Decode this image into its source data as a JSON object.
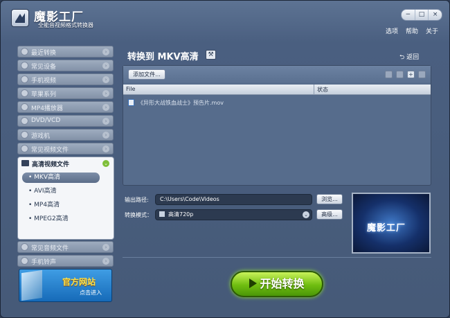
{
  "app": {
    "title": "魔影工厂",
    "subtitle": "全能音视频格式转换器",
    "top_links": [
      "选项",
      "帮助",
      "关于"
    ],
    "window_controls": [
      "−",
      "□",
      "×"
    ]
  },
  "sidebar": {
    "items_top": [
      {
        "label": "最近转换",
        "icon": "clock-icon"
      },
      {
        "label": "常见设备",
        "icon": "device-icon"
      },
      {
        "label": "手机视频",
        "icon": "phone-icon"
      },
      {
        "label": "苹果系列",
        "icon": "apple-icon"
      },
      {
        "label": "MP4播放器",
        "icon": "mp4-player-icon"
      },
      {
        "label": "DVD/VCD",
        "icon": "disc-icon"
      },
      {
        "label": "游戏机",
        "icon": "gamepad-icon"
      },
      {
        "label": "常见视频文件",
        "icon": "video-file-icon"
      }
    ],
    "open_group": {
      "label": "高清视频文件",
      "items": [
        "MKV高清",
        "AVI高清",
        "MP4高清",
        "MPEG2高清"
      ],
      "selected": "MKV高清"
    },
    "items_bottom": [
      {
        "label": "常见音频文件",
        "icon": "audio-file-icon"
      },
      {
        "label": "手机铃声",
        "icon": "ringtone-icon"
      }
    ],
    "promo": {
      "title": "官方网站",
      "sub": "点击进入"
    }
  },
  "main": {
    "title": "转换到 MKV高清",
    "back_label": "返回",
    "add_file_label": "添加文件...",
    "columns": {
      "file": "File",
      "status": "状态"
    },
    "files": [
      {
        "name": "《异形大战铁血战士》预告片.mov",
        "status": ""
      }
    ],
    "output_label": "输出路径:",
    "output_path": "C:\\Users\\Code\\Videos",
    "browse_label": "浏览...",
    "mode_label": "转换模式：",
    "mode_value": "高清720p",
    "advanced_label": "高级...",
    "preview_text": "魔影工厂",
    "start_label": "开始转换"
  }
}
